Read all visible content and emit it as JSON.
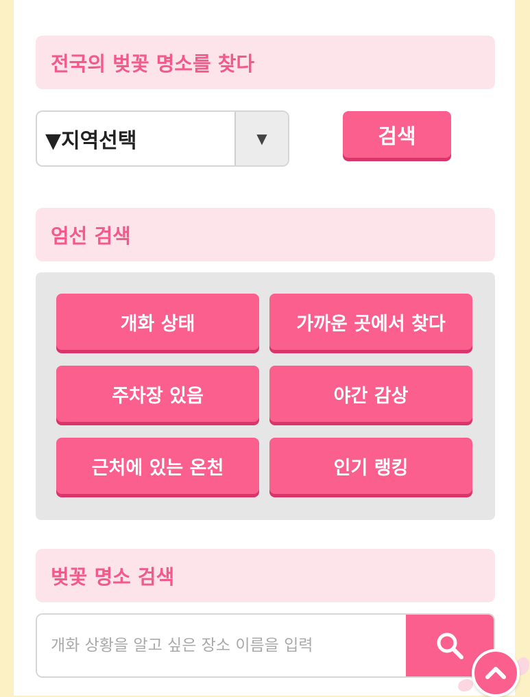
{
  "region_search": {
    "header": "전국의 벚꽃 명소를 찾다",
    "select_value": "▼지역선택",
    "search_label": "검색"
  },
  "curated_search": {
    "header": "엄선 검색",
    "buttons": [
      "개화 상태",
      "가까운 곳에서 찾다",
      "주차장 있음",
      "야간 감상",
      "근처에 있는 온천",
      "인기 랭킹"
    ]
  },
  "spot_search": {
    "header": "벚꽃 명소 검색",
    "placeholder": "개화 상황을 알고 싶은 장소 이름을 입력",
    "value": ""
  },
  "icons": {
    "select_arrow": "triangle-down-icon",
    "search": "magnifier-icon",
    "scroll_top": "chevron-up-icon"
  },
  "colors": {
    "accent": "#fb5f8e",
    "header_bg": "#fde3ea",
    "header_text": "#f25a8a",
    "page_border": "#fbf1c4"
  }
}
